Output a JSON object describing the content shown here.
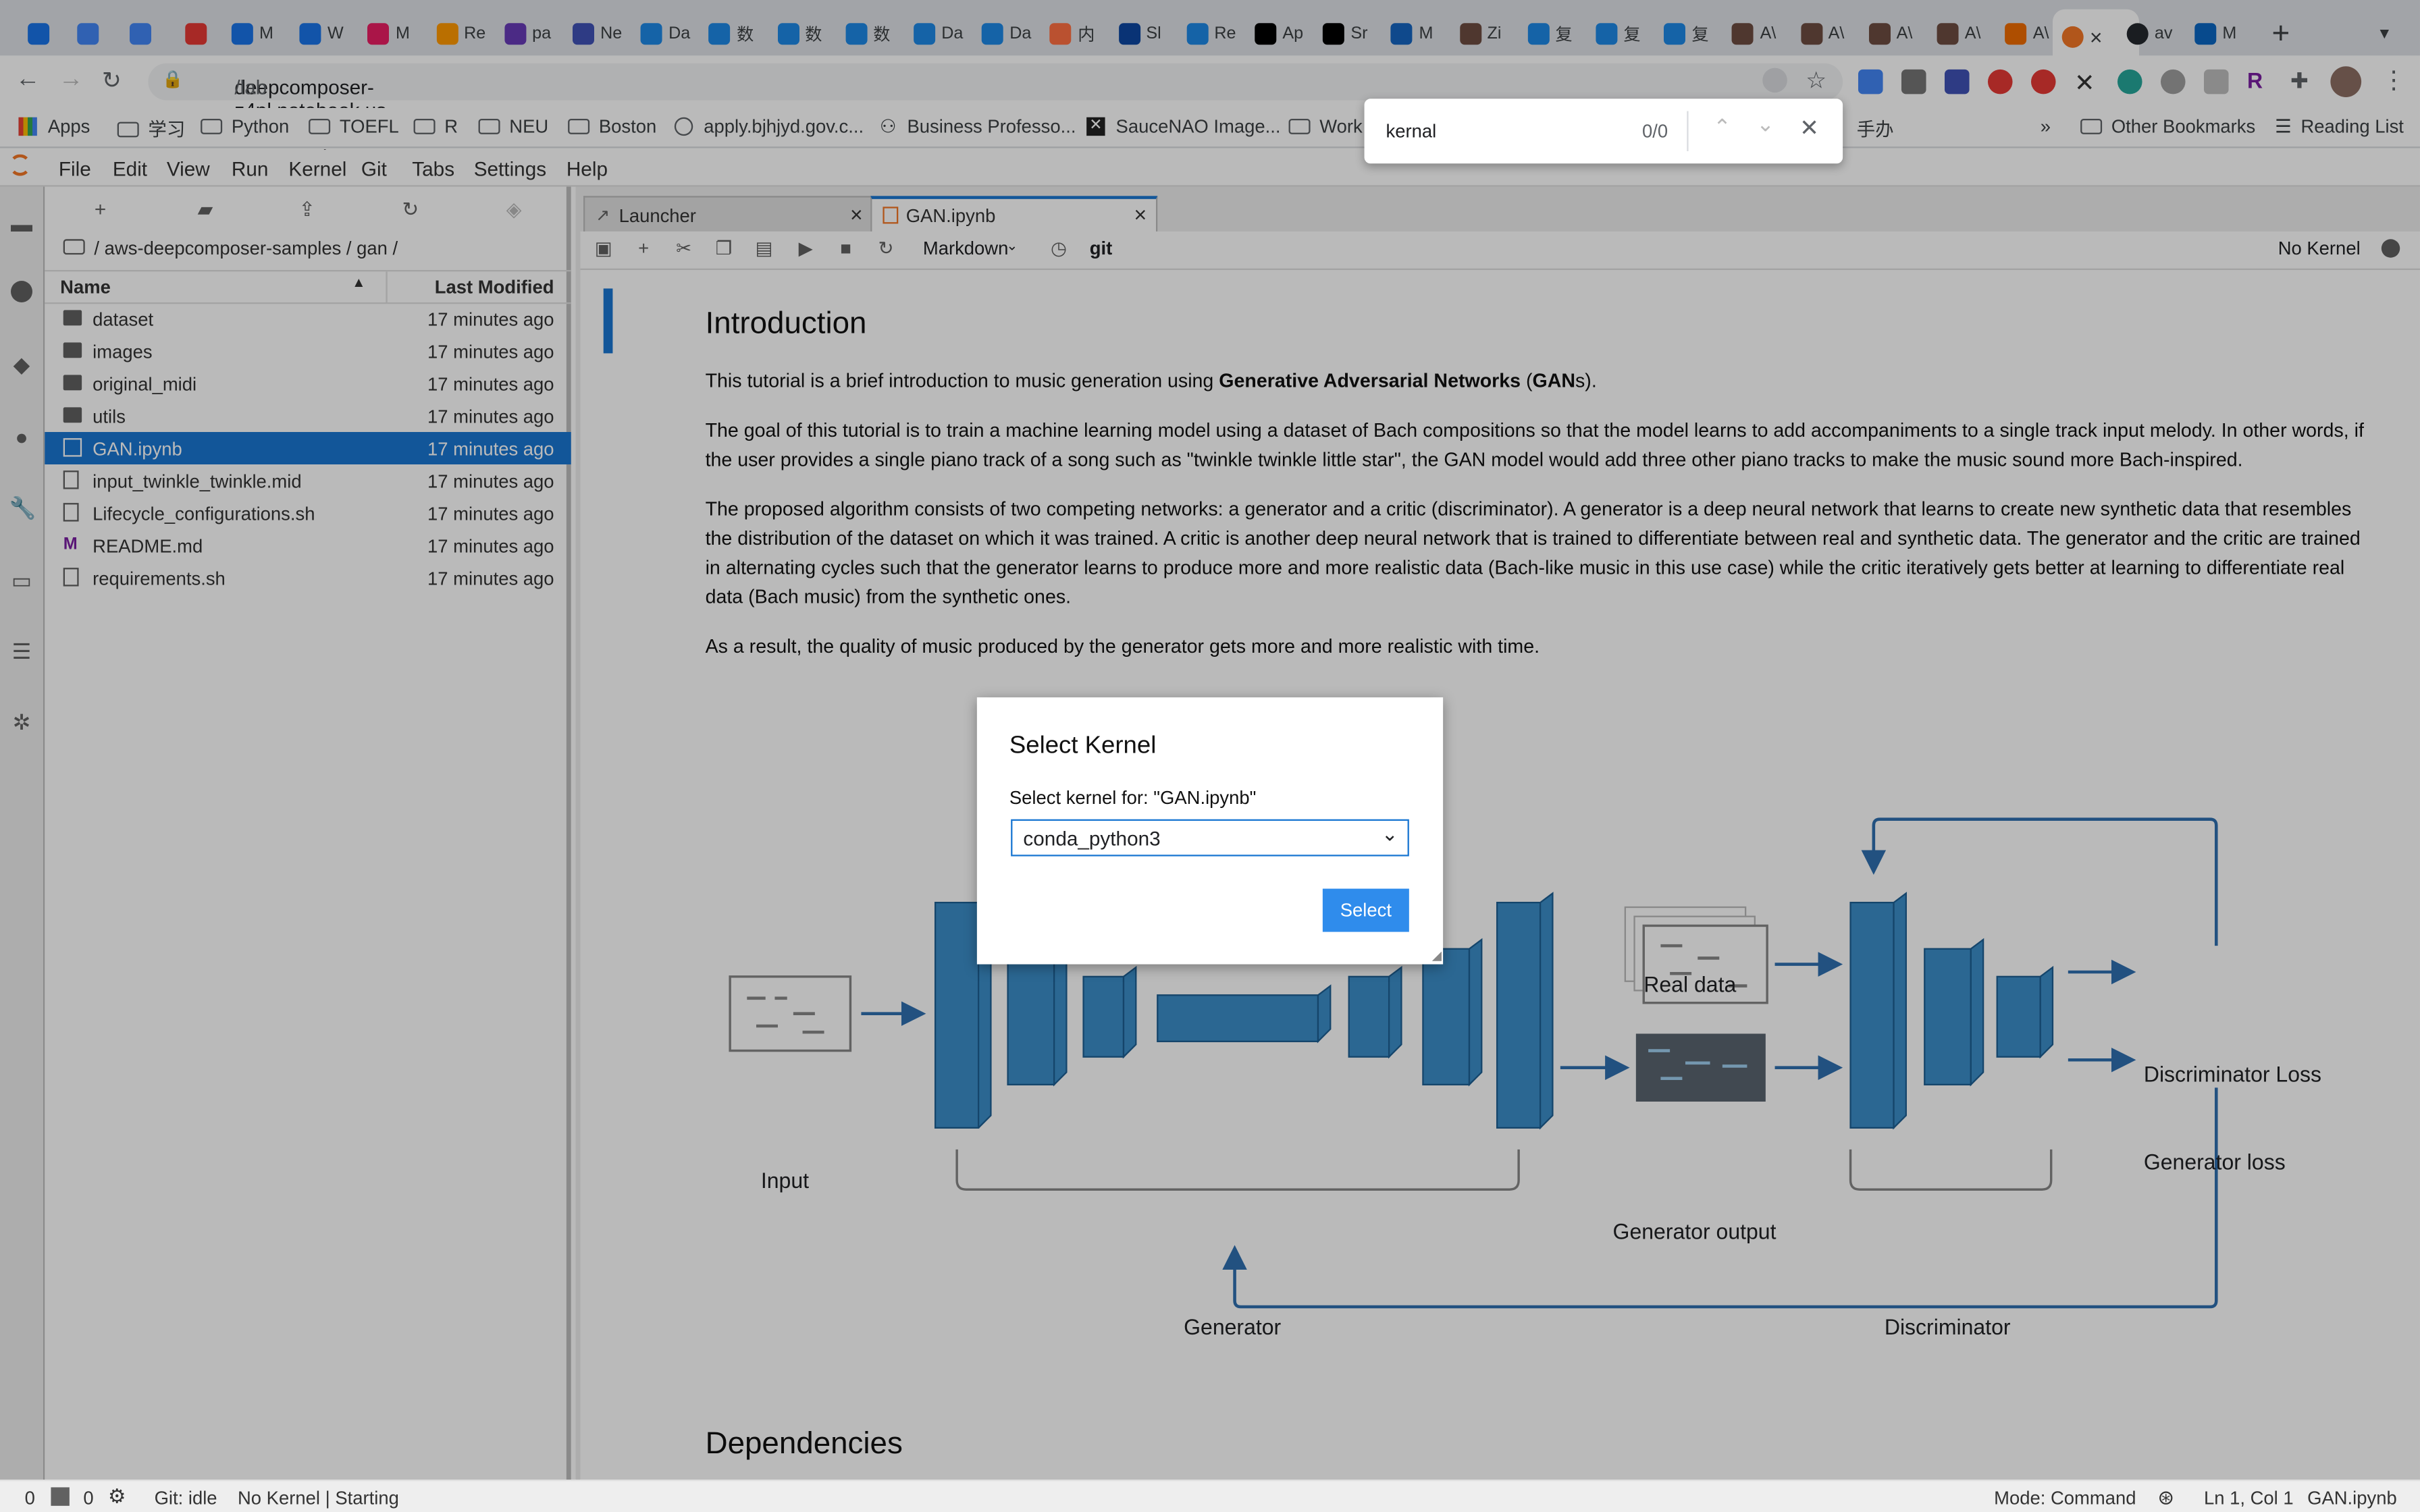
{
  "browser": {
    "tabs": [
      {
        "label": "M",
        "color": "#1a73e8"
      },
      {
        "label": "W",
        "color": "#1a73e8"
      },
      {
        "label": "M",
        "color": "#e91e63"
      },
      {
        "label": "Re",
        "color": "#ff9800"
      },
      {
        "label": "pa",
        "color": "#673ab7"
      },
      {
        "label": "Ne",
        "color": "#3f51b5"
      },
      {
        "label": "Da",
        "color": "#1e88e5"
      },
      {
        "label": "数",
        "color": "#1e88e5"
      },
      {
        "label": "数",
        "color": "#1e88e5"
      },
      {
        "label": "数",
        "color": "#1e88e5"
      },
      {
        "label": "Da",
        "color": "#1e88e5"
      },
      {
        "label": "Da",
        "color": "#1e88e5"
      },
      {
        "label": "内",
        "color": "#ff7043"
      },
      {
        "label": "Sl",
        "color": "#0d47a1"
      },
      {
        "label": "Re",
        "color": "#1e88e5"
      },
      {
        "label": "Ap",
        "color": "#000000"
      },
      {
        "label": "Sr",
        "color": "#000000"
      },
      {
        "label": "M",
        "color": "#1565c0"
      },
      {
        "label": "Zi",
        "color": "#6d4c41"
      },
      {
        "label": "复",
        "color": "#1e88e5"
      },
      {
        "label": "复",
        "color": "#1e88e5"
      },
      {
        "label": "复",
        "color": "#1e88e5"
      },
      {
        "label": "A\\",
        "color": "#6d4c41"
      },
      {
        "label": "A\\",
        "color": "#6d4c41"
      },
      {
        "label": "A\\",
        "color": "#6d4c41"
      },
      {
        "label": "A\\",
        "color": "#6d4c41"
      },
      {
        "label": "A\\",
        "color": "#ef6c00"
      }
    ],
    "active_tab_close": "×",
    "after_tabs": [
      {
        "label": "av",
        "color": "#24292e"
      },
      {
        "label": "M",
        "color": "#0a66c2"
      }
    ],
    "new_tab": "+",
    "url_host": "deepcomposer-z4pl.notebook.us-east-1.sagemaker.aws",
    "url_path": "/lab",
    "bookmarks": [
      "Apps",
      "学习",
      "Python",
      "TOEFL",
      "R",
      "NEU",
      "Boston",
      "apply.bjhjyd.gov.c...",
      "Business Professo...",
      "SauceNAO Image...",
      "Work",
      "手办"
    ],
    "other_bookmarks": "Other Bookmarks",
    "reading_list": "Reading List",
    "more": "»"
  },
  "findbar": {
    "query": "kernal",
    "count": "0/0"
  },
  "menubar": [
    "File",
    "Edit",
    "View",
    "Run",
    "Kernel",
    "Git",
    "Tabs",
    "Settings",
    "Help"
  ],
  "filebrowser": {
    "breadcrumb": "/ aws-deepcomposer-samples / gan /",
    "col_name": "Name",
    "col_modified": "Last Modified",
    "files": [
      {
        "name": "dataset",
        "type": "folder",
        "modified": "17 minutes ago"
      },
      {
        "name": "images",
        "type": "folder",
        "modified": "17 minutes ago"
      },
      {
        "name": "original_midi",
        "type": "folder",
        "modified": "17 minutes ago"
      },
      {
        "name": "utils",
        "type": "folder",
        "modified": "17 minutes ago"
      },
      {
        "name": "GAN.ipynb",
        "type": "notebook",
        "modified": "17 minutes ago",
        "selected": true
      },
      {
        "name": "input_twinkle_twinkle.mid",
        "type": "file",
        "modified": "17 minutes ago"
      },
      {
        "name": "Lifecycle_configurations.sh",
        "type": "file",
        "modified": "17 minutes ago"
      },
      {
        "name": "README.md",
        "type": "markdown",
        "modified": "17 minutes ago"
      },
      {
        "name": "requirements.sh",
        "type": "file",
        "modified": "17 minutes ago"
      }
    ]
  },
  "doc_tabs": [
    {
      "label": "Launcher"
    },
    {
      "label": "GAN.ipynb"
    }
  ],
  "nb_toolbar": {
    "cell_type": "Markdown",
    "git": "git",
    "kernel": "No Kernel"
  },
  "notebook": {
    "heading": "Introduction",
    "p1_a": "This tutorial is a brief introduction to music generation using ",
    "p1_b": "Generative Adversarial Networks",
    "p1_c": " (",
    "p1_d": "GAN",
    "p1_e": "s).",
    "p2": "The goal of this tutorial is to train a machine learning model using a dataset of Bach compositions so that the model learns to add accompaniments to a single track input melody. In other words, if the user provides a single piano track of a song such as \"twinkle twinkle little star\", the GAN model would add three other piano tracks to make the music sound more Bach-inspired.",
    "p3": "The proposed algorithm consists of two competing networks: a generator and a critic (discriminator). A generator is a deep neural network that learns to create new synthetic data that resembles the distribution of the dataset on which it was trained. A critic is another deep neural network that is trained to differentiate between real and synthetic data. The generator and the critic are trained in alternating cycles such that the generator learns to produce more and more realistic data (Bach-like music in this use case) while the critic iteratively gets better at learning to differentiate real data (Bach music) from the synthetic ones.",
    "p4": "As a result, the quality of music produced by the generator gets more and more realistic with time.",
    "heading2": "Dependencies",
    "diagram": {
      "input": "Input",
      "real_data": "Real data",
      "generator_output": "Generator output",
      "generator": "Generator",
      "discriminator": "Discriminator",
      "disc_loss": "Discriminator Loss",
      "gen_loss": "Generator loss"
    }
  },
  "dialog": {
    "title": "Select Kernel",
    "label": "Select kernel for: \"GAN.ipynb\"",
    "selected": "conda_python3",
    "button": "Select"
  },
  "statusbar": {
    "count1": "0",
    "count2": "0",
    "git": "Git: idle",
    "kernel": "No Kernel | Starting",
    "mode": "Mode: Command",
    "position": "Ln 1, Col 1",
    "file": "GAN.ipynb"
  },
  "colors": {
    "accent": "#1976d2",
    "diagram_blue": "#3b8ec9",
    "select_btn": "#2f8cec"
  }
}
